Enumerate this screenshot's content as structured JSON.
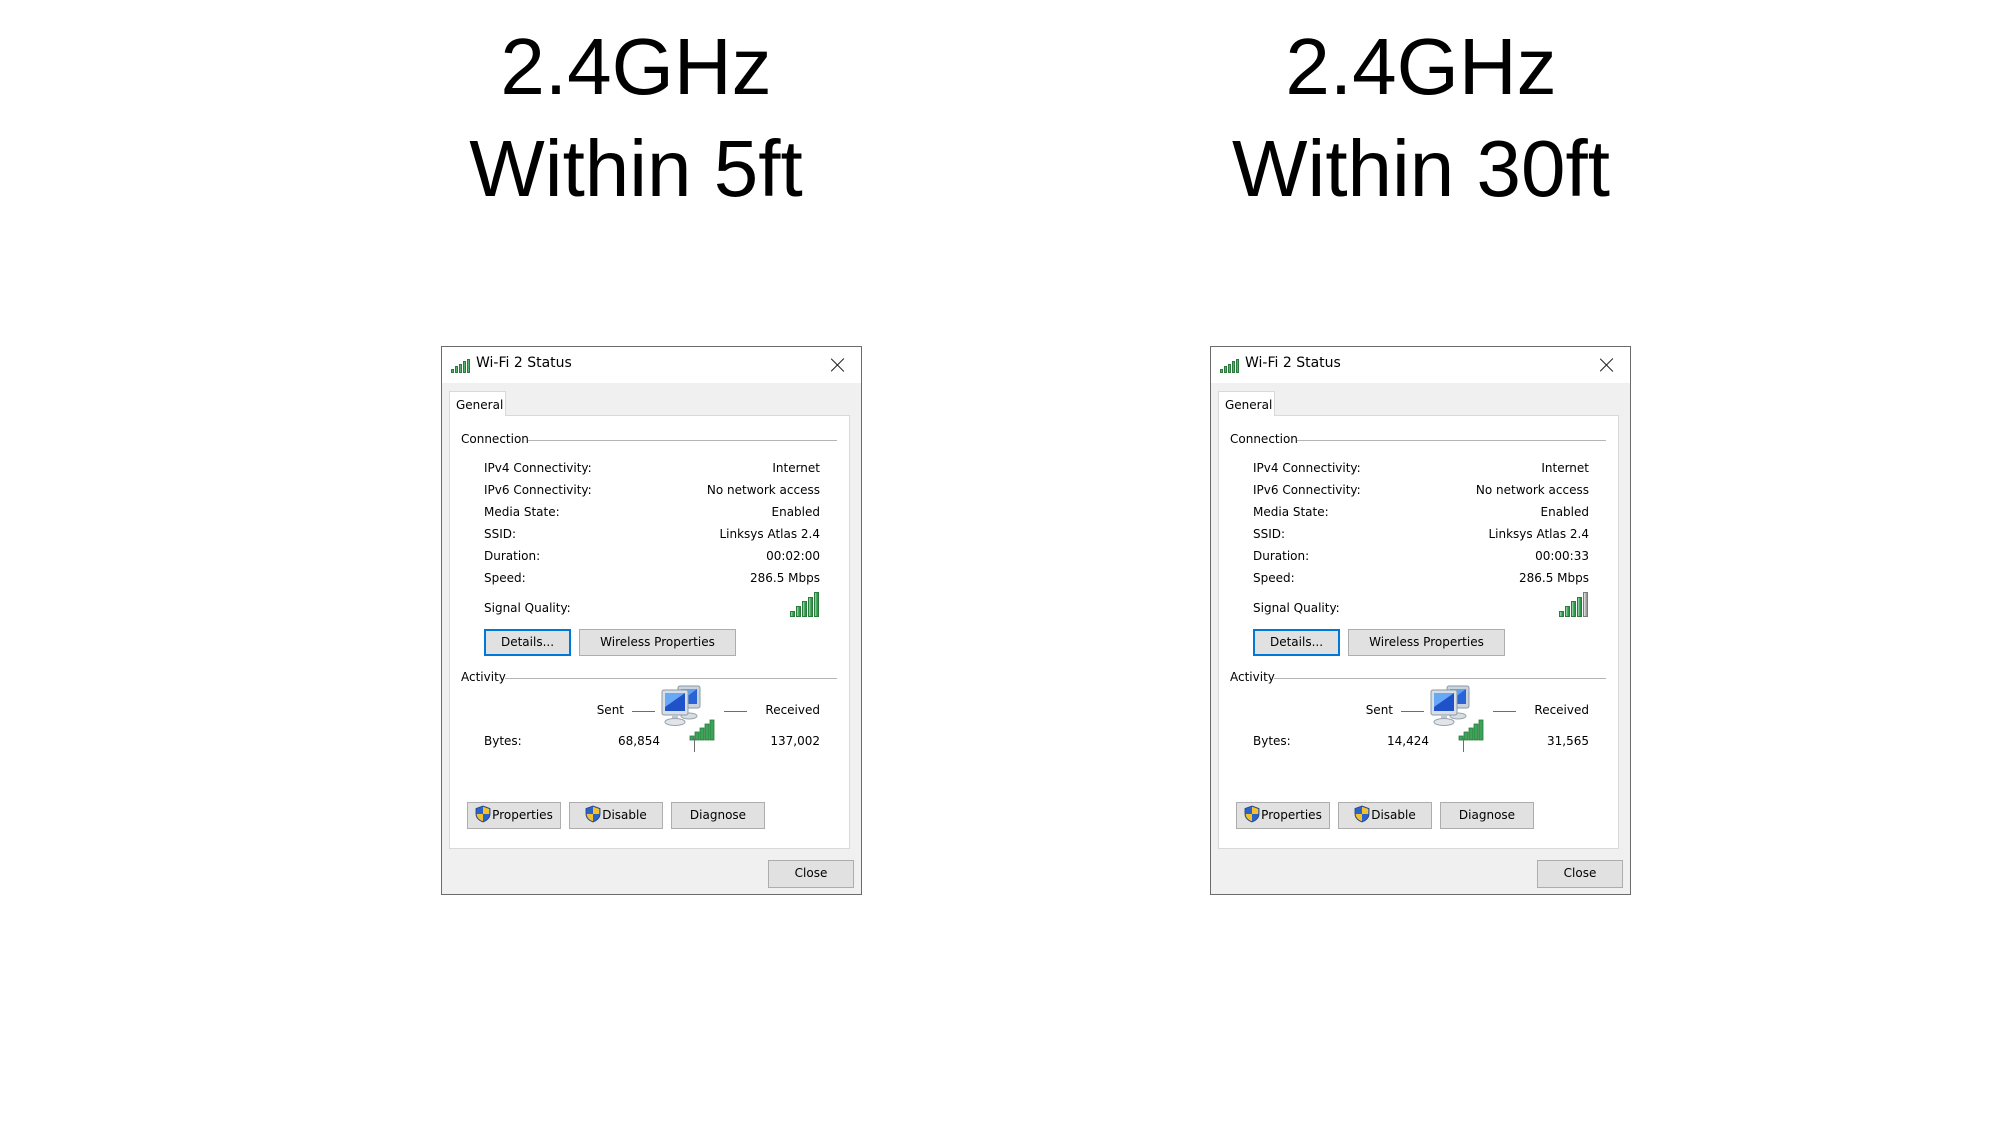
{
  "headings": [
    {
      "band": "2.4GHz",
      "distance": "Within 5ft"
    },
    {
      "band": "2.4GHz",
      "distance": "Within 30ft"
    }
  ],
  "dialogs": [
    {
      "title": "Wi-Fi 2 Status",
      "title_icon": "wifi-signal-icon",
      "tab": "General",
      "connection": {
        "label": "Connection",
        "rows": [
          {
            "label": "IPv4 Connectivity:",
            "value": "Internet"
          },
          {
            "label": "IPv6 Connectivity:",
            "value": "No network access"
          },
          {
            "label": "Media State:",
            "value": "Enabled"
          },
          {
            "label": "SSID:",
            "value": "Linksys Atlas 2.4"
          },
          {
            "label": "Duration:",
            "value": "00:02:00"
          },
          {
            "label": "Speed:",
            "value": "286.5 Mbps"
          }
        ],
        "signal_label": "Signal Quality:",
        "signal_bars": 5,
        "signal_bars_max": 5
      },
      "buttons": {
        "details": "Details...",
        "wireless_properties": "Wireless Properties"
      },
      "activity": {
        "label": "Activity",
        "sent_label": "Sent",
        "received_label": "Received",
        "bytes_label": "Bytes:",
        "bytes_sent": "68,854",
        "bytes_received": "137,002",
        "icon": "network-computers-icon"
      },
      "actions": {
        "properties": "Properties",
        "disable": "Disable",
        "diagnose": "Diagnose",
        "close": "Close"
      },
      "colors": {
        "signal_on": "#3aa457",
        "signal_off": "#b0b0b0",
        "default_button_border": "#0078d7"
      }
    },
    {
      "title": "Wi-Fi 2 Status",
      "title_icon": "wifi-signal-icon",
      "tab": "General",
      "connection": {
        "label": "Connection",
        "rows": [
          {
            "label": "IPv4 Connectivity:",
            "value": "Internet"
          },
          {
            "label": "IPv6 Connectivity:",
            "value": "No network access"
          },
          {
            "label": "Media State:",
            "value": "Enabled"
          },
          {
            "label": "SSID:",
            "value": "Linksys Atlas 2.4"
          },
          {
            "label": "Duration:",
            "value": "00:00:33"
          },
          {
            "label": "Speed:",
            "value": "286.5 Mbps"
          }
        ],
        "signal_label": "Signal Quality:",
        "signal_bars": 4,
        "signal_bars_max": 5
      },
      "buttons": {
        "details": "Details...",
        "wireless_properties": "Wireless Properties"
      },
      "activity": {
        "label": "Activity",
        "sent_label": "Sent",
        "received_label": "Received",
        "bytes_label": "Bytes:",
        "bytes_sent": "14,424",
        "bytes_received": "31,565",
        "icon": "network-computers-icon"
      },
      "actions": {
        "properties": "Properties",
        "disable": "Disable",
        "diagnose": "Diagnose",
        "close": "Close"
      },
      "colors": {
        "signal_on": "#3aa457",
        "signal_off": "#b0b0b0",
        "default_button_border": "#0078d7"
      }
    }
  ]
}
